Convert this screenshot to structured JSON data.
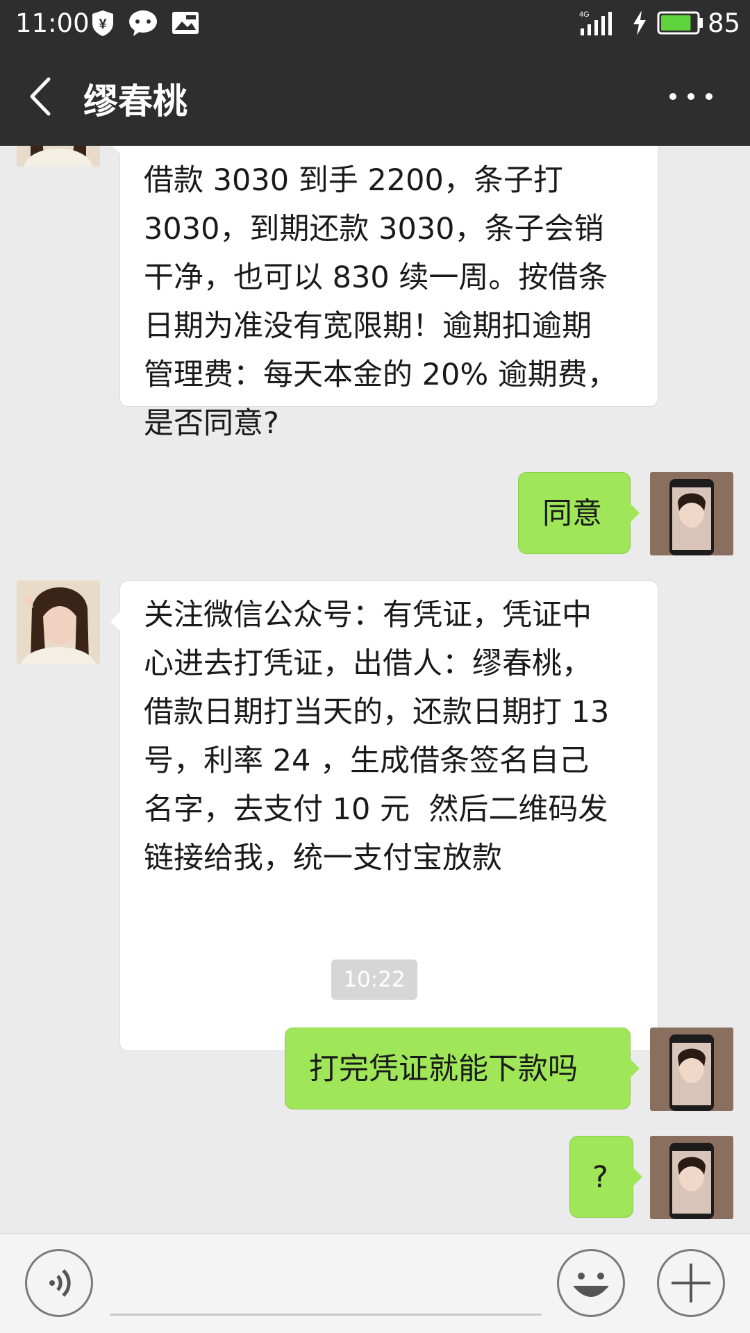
{
  "status_bar": {
    "time": "11:00",
    "network": "4G",
    "battery": "85",
    "icons": [
      "wallet-shield-icon",
      "message-bubble-icon",
      "picture-message-icon",
      "signal-icon",
      "charging-icon",
      "battery-icon"
    ]
  },
  "nav": {
    "title": "缪春桃",
    "back_icon": "chevron-left-icon",
    "more_icon": "more-dots-icon"
  },
  "messages": [
    {
      "from": "contact",
      "lines": [
        "借款 3030 到手 2200，条子打",
        "3030，到期还款 3030，条子会销",
        "干净，也可以 830 续一周。按借条",
        "日期为准没有宽限期！逾期扣逾期",
        "管理费：每天本金的 20% 逾期费，",
        "是否同意?"
      ]
    },
    {
      "from": "me",
      "lines": [
        "同意"
      ]
    },
    {
      "from": "contact",
      "lines": [
        "关注微信公众号：有凭证，凭证中",
        "心进去打凭证，出借人：缪春桃，",
        "借款日期打当天的，还款日期打 13",
        "号，利率 24 ，生成借条签名自己",
        "名字，去支付 10 元  然后二维码发",
        "链接给我，统一支付宝放款"
      ]
    },
    {
      "from": "me",
      "lines": [
        "打完凭证就能下款吗"
      ]
    },
    {
      "from": "me",
      "lines": [
        "?"
      ]
    }
  ],
  "timestamp": "10:22",
  "colors": {
    "header_bg": "#2e2e2e",
    "chat_bg": "#ebebeb",
    "outgoing_bubble": "#9fe658",
    "incoming_bubble": "#ffffff",
    "battery_fill": "#5fd33b"
  },
  "input_bar": {
    "voice_icon": "voice-icon",
    "emoji_icon": "emoji-icon",
    "plus_icon": "plus-icon"
  }
}
